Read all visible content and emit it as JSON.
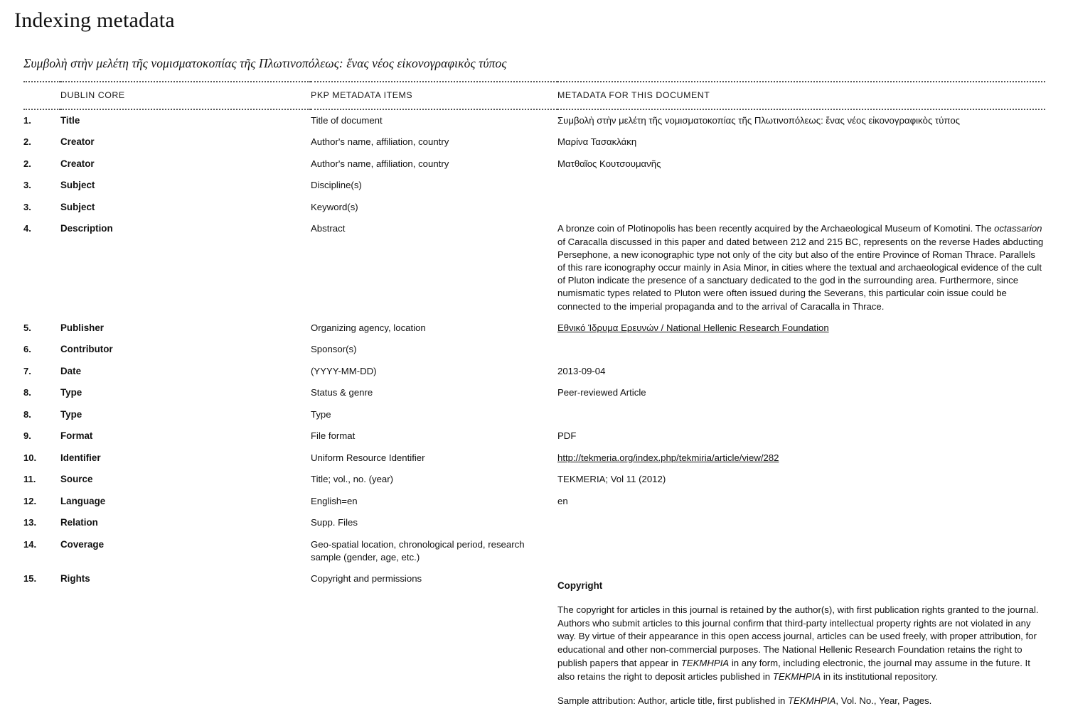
{
  "page": {
    "heading": "Indexing metadata",
    "document_subtitle": "Συμβολὴ στὴν μελέτη τῆς νομισματοκοπίας τῆς Πλωτινοπόλεως: ἕνας νέος εἰκονογραφικὸς τύπος"
  },
  "table": {
    "headers": {
      "number": "",
      "dublin_core": "DUBLIN CORE",
      "pkp_metadata_items": "PKP METADATA ITEMS",
      "metadata_for_this_document": "METADATA FOR THIS DOCUMENT"
    },
    "rows": [
      {
        "num": "1.",
        "dc": "Title",
        "pkp": "Title of document",
        "value": "Συμβολὴ στὴν μελέτη τῆς νομισματοκοπίας τῆς Πλωτινοπόλεως: ἕνας νέος εἰκονογραφικὸς τύπος"
      },
      {
        "num": "2.",
        "dc": "Creator",
        "pkp": "Author's name, affiliation, country",
        "value": "Μαρίνα Τασακλάκη"
      },
      {
        "num": "2.",
        "dc": "Creator",
        "pkp": "Author's name, affiliation, country",
        "value": "Ματθαῖος Κουτσουμανῆς"
      },
      {
        "num": "3.",
        "dc": "Subject",
        "pkp": "Discipline(s)",
        "value": ""
      },
      {
        "num": "3.",
        "dc": "Subject",
        "pkp": "Keyword(s)",
        "value": ""
      },
      {
        "num": "4.",
        "dc": "Description",
        "pkp": "Abstract",
        "value": ""
      },
      {
        "num": "5.",
        "dc": "Publisher",
        "pkp": "Organizing agency, location",
        "value": ""
      },
      {
        "num": "6.",
        "dc": "Contributor",
        "pkp": "Sponsor(s)",
        "value": ""
      },
      {
        "num": "7.",
        "dc": "Date",
        "pkp": "(YYYY-MM-DD)",
        "value": "2013-09-04"
      },
      {
        "num": "8.",
        "dc": "Type",
        "pkp": "Status & genre",
        "value": "Peer-reviewed Article"
      },
      {
        "num": "8.",
        "dc": "Type",
        "pkp": "Type",
        "value": ""
      },
      {
        "num": "9.",
        "dc": "Format",
        "pkp": "File format",
        "value": "PDF"
      },
      {
        "num": "10.",
        "dc": "Identifier",
        "pkp": "Uniform Resource Identifier",
        "value": ""
      },
      {
        "num": "11.",
        "dc": "Source",
        "pkp": "Title; vol., no. (year)",
        "value": "TEKMERIA; Vol 11 (2012)"
      },
      {
        "num": "12.",
        "dc": "Language",
        "pkp": "English=en",
        "value": "en"
      },
      {
        "num": "13.",
        "dc": "Relation",
        "pkp": "Supp. Files",
        "value": ""
      },
      {
        "num": "14.",
        "dc": "Coverage",
        "pkp": "Geo-spatial location, chronological period, research sample (gender, age, etc.)",
        "value": ""
      },
      {
        "num": "15.",
        "dc": "Rights",
        "pkp": "Copyright and permissions",
        "value": ""
      }
    ]
  },
  "abstract": {
    "part1": "A bronze coin of Plotinopolis has been recently acquired by the Archaeological Museum of Komotini. The ",
    "italic1": "octassarion",
    "part2": " of Caracalla discussed in this paper and dated between 212 and 215 BC, represents on the reverse Hades abducting Persephone, a new iconographic type not only of the city but also of the entire Province of Roman Thrace. Parallels of this rare iconography occur mainly in Asia Minor, in cities where the textual and archaeological evidence of the cult of Pluton indicate the presence of a sanctuary dedicated to the god in the surrounding area. Furthermore, since numismatic types related to Pluton were often issued during the Severans, this particular coin issue could be connected to the imperial propaganda and to the arrival of Caracalla in Thrace."
  },
  "publisher_link": "Εθνικό Ίδρυμα Ερευνών / National Hellenic Research Foundation",
  "identifier_link": "http://tekmeria.org/index.php/tekmiria/article/view/282",
  "rights": {
    "heading": "Copyright",
    "para1_a": "The copyright for articles in this journal is retained by the author(s), with first publication rights granted to the journal. Authors who submit articles to this journal confirm that third-party intellectual property rights are not violated in any way. By virtue of their appearance in this open access journal, articles can be used freely, with proper attribution, for educational and other non-commercial purposes. The National Hellenic Research Foundation retains the right to publish papers that appear in ",
    "para1_journal1": "TEKMHPIA",
    "para1_b": " in any form, including electronic, the journal may assume in the future. It also retains the right to deposit articles published in ",
    "para1_journal2": "TEKMHPIA",
    "para1_c": " in its institutional repository.",
    "para2_a": "Sample attribution: Author, article title, first published in ",
    "para2_journal": "TEKMHPIA",
    "para2_b": ", Vol. No., Year, Pages."
  },
  "colors": {
    "text": "#111111",
    "rule": "#555555",
    "background": "#ffffff"
  }
}
